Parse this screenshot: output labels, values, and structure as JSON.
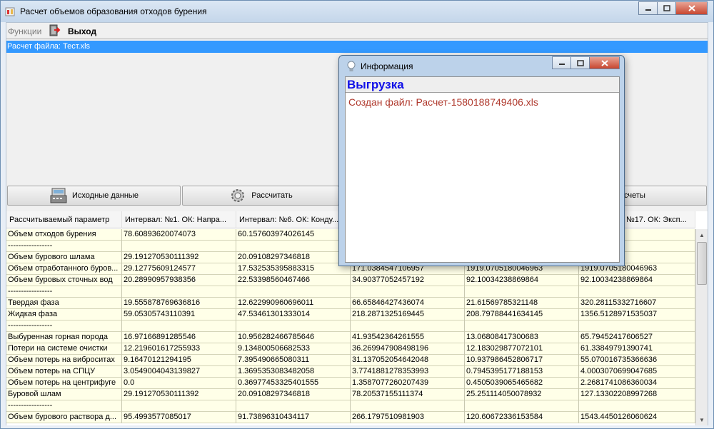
{
  "window": {
    "title": "Расчет объемов образования отходов бурения"
  },
  "menu": {
    "functions": "Функции",
    "exit": "Выход"
  },
  "list": {
    "selected_item": "Расчет файла: Тест.xls"
  },
  "buttons": {
    "source_data": "Исходные данные",
    "calculate": "Рассчитать",
    "save_calc": "ть расчеты"
  },
  "table": {
    "columns": [
      "Рассчитываемый параметр",
      "Интервал:  №1. ОК: Напра...",
      "Интервал:  №6. ОК: Конду...",
      "",
      "",
      "№17. ОК: Эксп..."
    ],
    "rows": [
      [
        "Объем отходов бурения",
        "78.60893620074073",
        "60.157603974026145",
        "",
        "",
        "4833676"
      ],
      [
        "-----------------",
        "",
        "",
        "",
        "",
        ""
      ],
      [
        "Объем бурового шлама",
        "29.191270530111392",
        "20.09108297346818",
        "",
        "",
        "8997268"
      ],
      [
        "Объем отработанного буров...",
        "29.12775609124577",
        "17.532535395883315",
        "171.0384547106957",
        "1919.0705180046963",
        "1919.0705180046963"
      ],
      [
        "Объем буровых сточных вод",
        "20.28990957938356",
        "22.53398560467466",
        "34.90377052457192",
        "92.10034238869864",
        "92.10034238869864"
      ],
      [
        "-----------------",
        "",
        "",
        "",
        "",
        ""
      ],
      [
        "Твердая фаза",
        "19.555878769636816",
        "12.622990960696011",
        "66.65846427436074",
        "21.61569785321148",
        "320.28115332716607"
      ],
      [
        "Жидкая фаза",
        "59.05305743110391",
        "47.53461301333014",
        "218.2871325169445",
        "208.79788441634145",
        "1356.5128971535037"
      ],
      [
        "-----------------",
        "",
        "",
        "",
        "",
        ""
      ],
      [
        "Выбуренная горная порода",
        "16.97166891285546",
        "10.956282466785646",
        "41.93542364261555",
        "13.06808417300683",
        "65.79452417606527"
      ],
      [
        "Потери на системе очистки",
        "12.219601617255933",
        "9.134800506682533",
        "36.269947908498196",
        "12.183029877072101",
        "61.33849791390741"
      ],
      [
        "Объем потерь на виброситах",
        "9.16470121294195",
        "7.395490665080311",
        "31.137052054642048",
        "10.937986452806717",
        "55.070016735366636"
      ],
      [
        "Объем потерь на СПЦУ",
        "3.054900404313982​7",
        "1.3695353083482058",
        "3.7741881278353993",
        "0.7945395177188153",
        "4.0003070699047685"
      ],
      [
        "Объем потерь на центрифуге",
        "0.0",
        "0.36977453325401555",
        "1.3587077260207439",
        "0.4505039065465682",
        "2.2681741086360034"
      ],
      [
        "Буровой шлам",
        "29.191270530111392",
        "20.09108297346818",
        "78.20537155111374",
        "25.251114050078932",
        "127.13302208997268"
      ],
      [
        "-----------------",
        "",
        "",
        "",
        "",
        ""
      ],
      [
        "Объем бурового раствора д...",
        "95.4993577085017",
        "91.73896310434117",
        "266.1797510981903",
        "120.60672336153584",
        "1543.4450126060624"
      ]
    ]
  },
  "dialog": {
    "title": "Информация",
    "heading": "Выгрузка",
    "message": "Создан файл: Расчет-1580188749406.xls"
  }
}
